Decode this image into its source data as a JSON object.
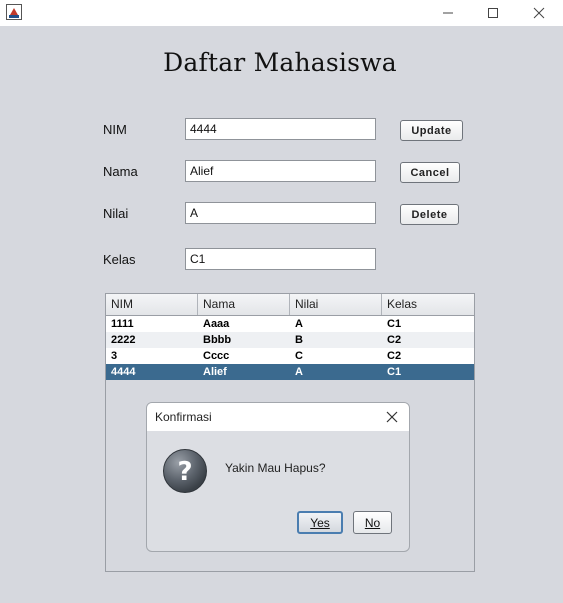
{
  "window": {
    "controls": {
      "minimize": "minimize",
      "maximize": "maximize",
      "close": "close"
    }
  },
  "header": {
    "title": "Daftar Mahasiswa"
  },
  "form": {
    "nim": {
      "label": "NIM",
      "value": "4444"
    },
    "nama": {
      "label": "Nama",
      "value": "Alief"
    },
    "nilai": {
      "label": "Nilai",
      "value": "A"
    },
    "kelas": {
      "label": "Kelas",
      "value": "C1"
    }
  },
  "buttons": {
    "update": "Update",
    "cancel": "Cancel",
    "delete": "Delete"
  },
  "table": {
    "columns": [
      "NIM",
      "Nama",
      "Nilai",
      "Kelas"
    ],
    "rows": [
      [
        "1111",
        "Aaaa",
        "A",
        "C1"
      ],
      [
        "2222",
        "Bbbb",
        "B",
        "C2"
      ],
      [
        "3",
        "Cccc",
        "C",
        "C2"
      ],
      [
        "4444",
        "Alief",
        "A",
        "C1"
      ]
    ],
    "selected_row": 3
  },
  "dialog": {
    "title": "Konfirmasi",
    "message": "Yakin Mau Hapus?",
    "yes_label": "Yes",
    "no_label": "No",
    "icon": "question-icon"
  },
  "colors": {
    "selection": "#3b6a8f",
    "background": "#d6d8de"
  }
}
